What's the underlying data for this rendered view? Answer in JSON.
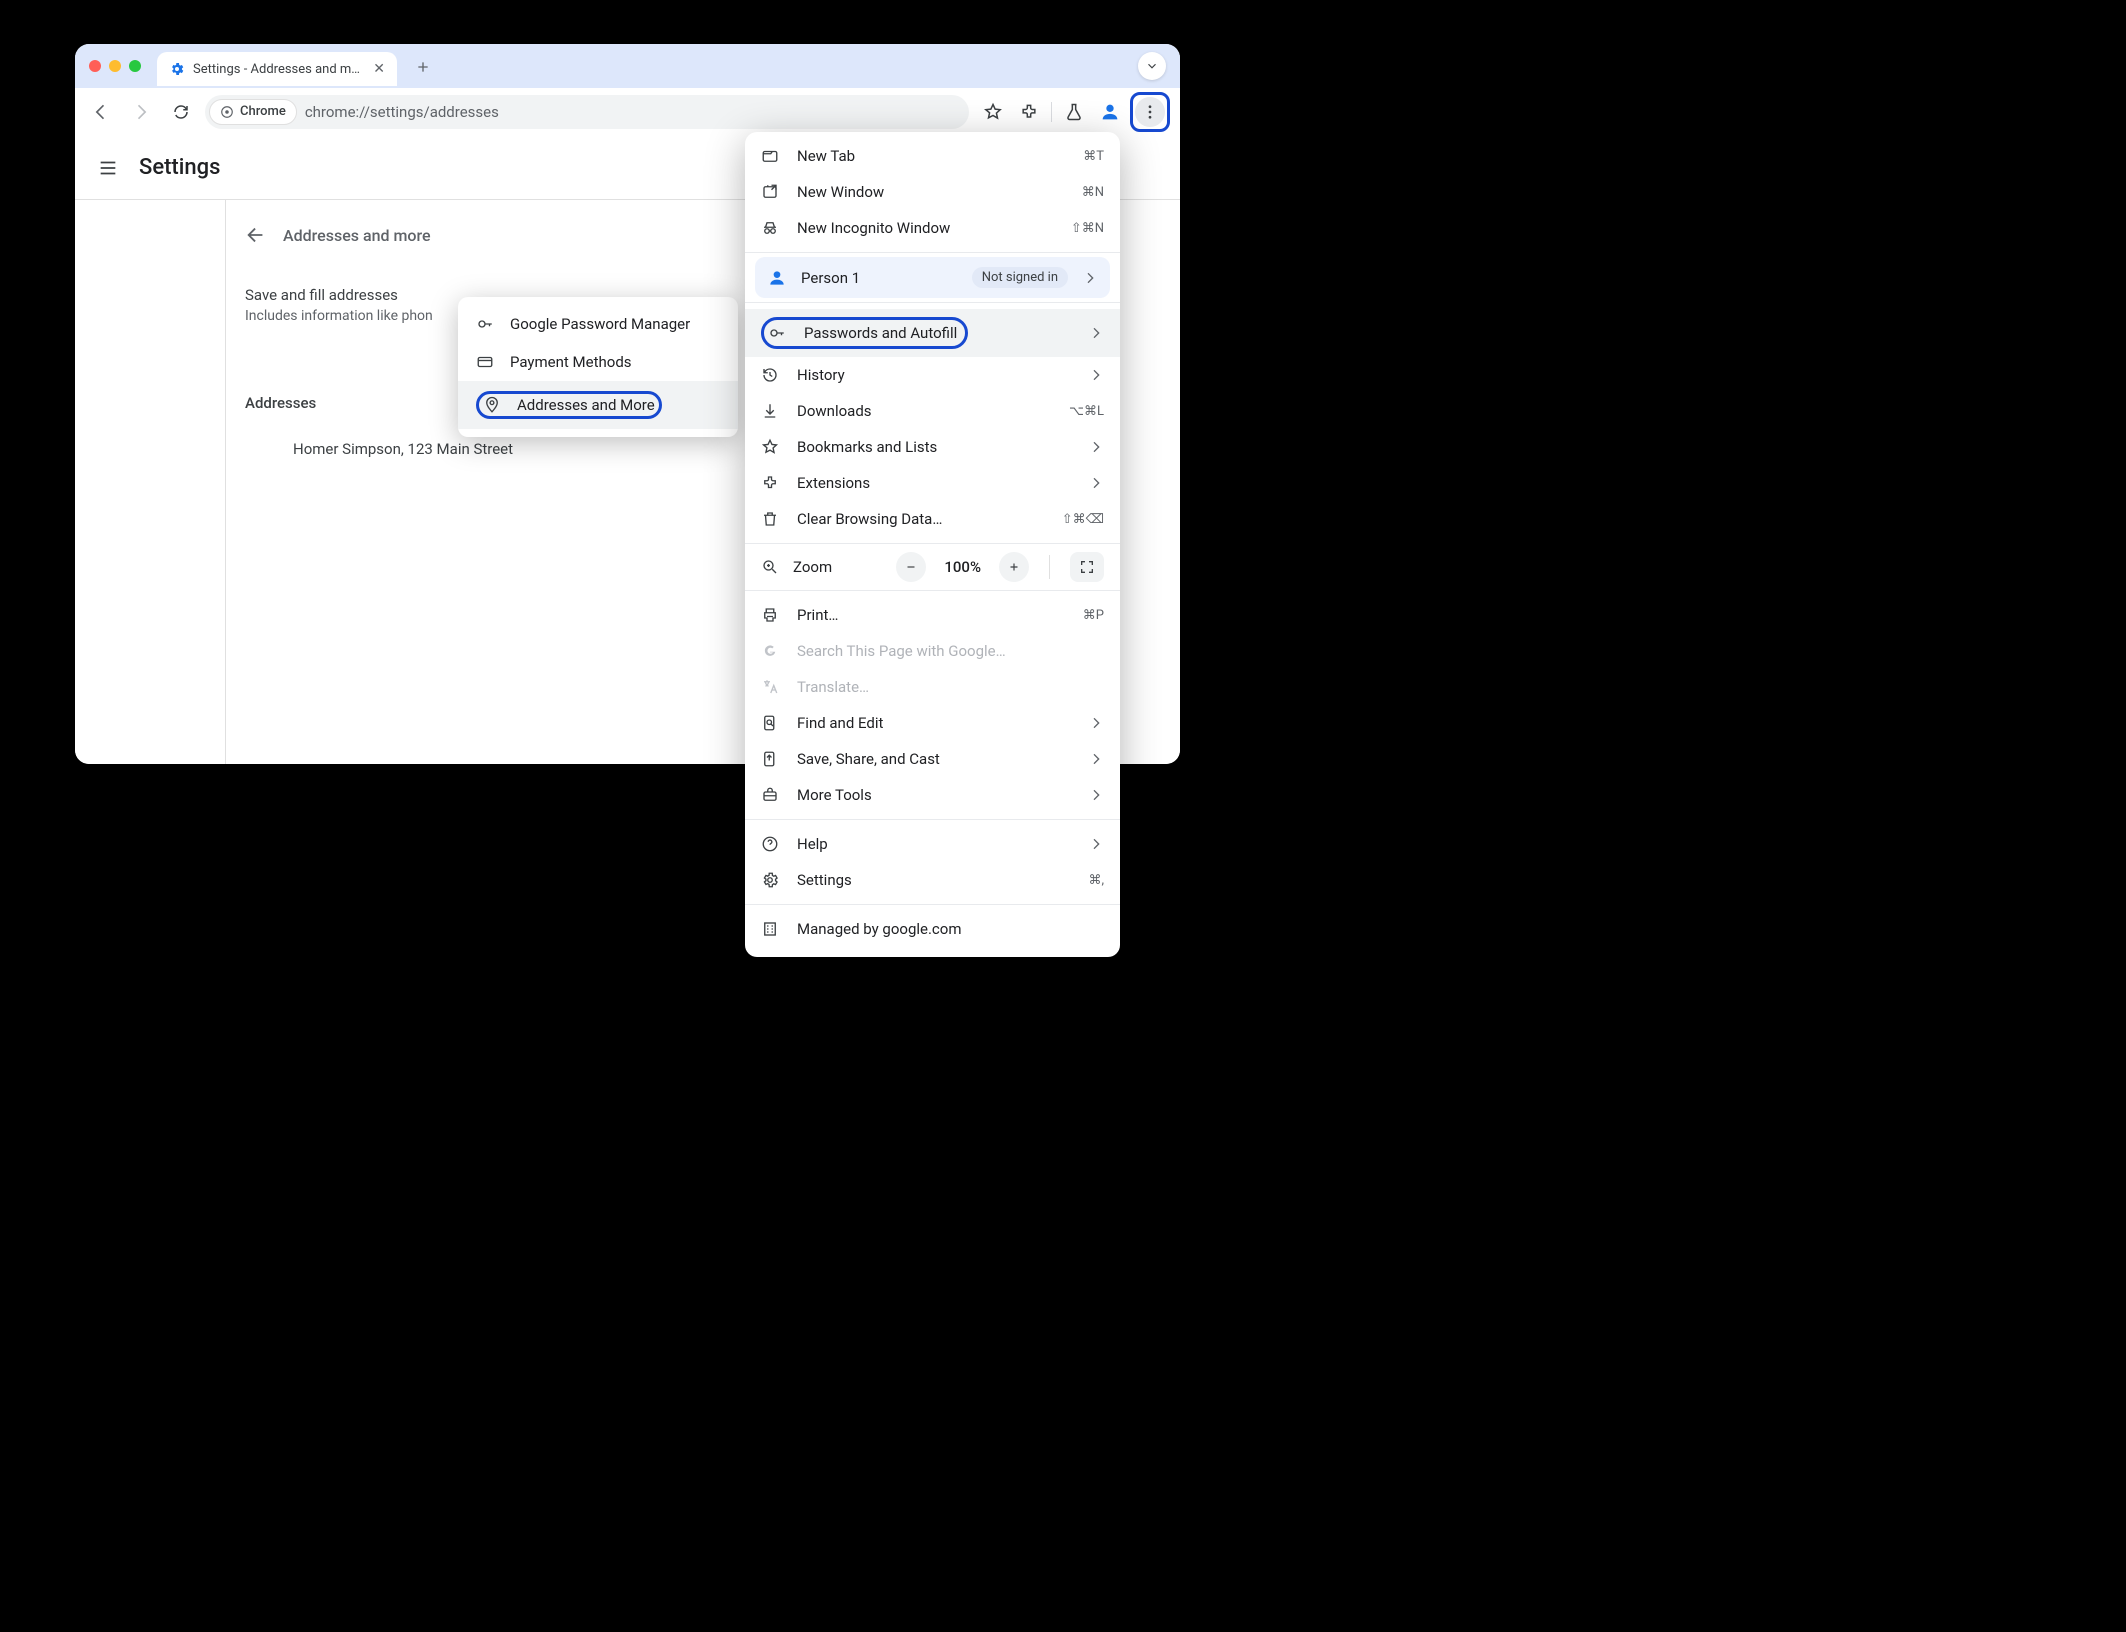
{
  "tab": {
    "title": "Settings - Addresses and more"
  },
  "omnibox": {
    "chip": "Chrome",
    "url": "chrome://settings/addresses"
  },
  "app": {
    "title": "Settings"
  },
  "page": {
    "section_title": "Addresses and more",
    "save_label": "Save and fill addresses",
    "save_sub": "Includes information like phon",
    "addresses_heading": "Addresses",
    "address_entry": "Homer Simpson, 123 Main Street"
  },
  "submenu": {
    "items": [
      {
        "label": "Google Password Manager"
      },
      {
        "label": "Payment Methods"
      },
      {
        "label": "Addresses and More"
      }
    ]
  },
  "menu": {
    "new_tab": "New Tab",
    "new_tab_sc": "⌘T",
    "new_window": "New Window",
    "new_window_sc": "⌘N",
    "new_incognito": "New Incognito Window",
    "new_incognito_sc": "⇧⌘N",
    "profile_name": "Person 1",
    "profile_badge": "Not signed in",
    "passwords": "Passwords and Autofill",
    "history": "History",
    "downloads": "Downloads",
    "downloads_sc": "⌥⌘L",
    "bookmarks": "Bookmarks and Lists",
    "extensions": "Extensions",
    "clear": "Clear Browsing Data…",
    "clear_sc": "⇧⌘⌫",
    "zoom_label": "Zoom",
    "zoom_value": "100%",
    "print": "Print…",
    "print_sc": "⌘P",
    "search": "Search This Page with Google…",
    "translate": "Translate…",
    "find": "Find and Edit",
    "save_share": "Save, Share, and Cast",
    "more_tools": "More Tools",
    "help": "Help",
    "settings": "Settings",
    "settings_sc": "⌘,",
    "managed": "Managed by google.com"
  }
}
